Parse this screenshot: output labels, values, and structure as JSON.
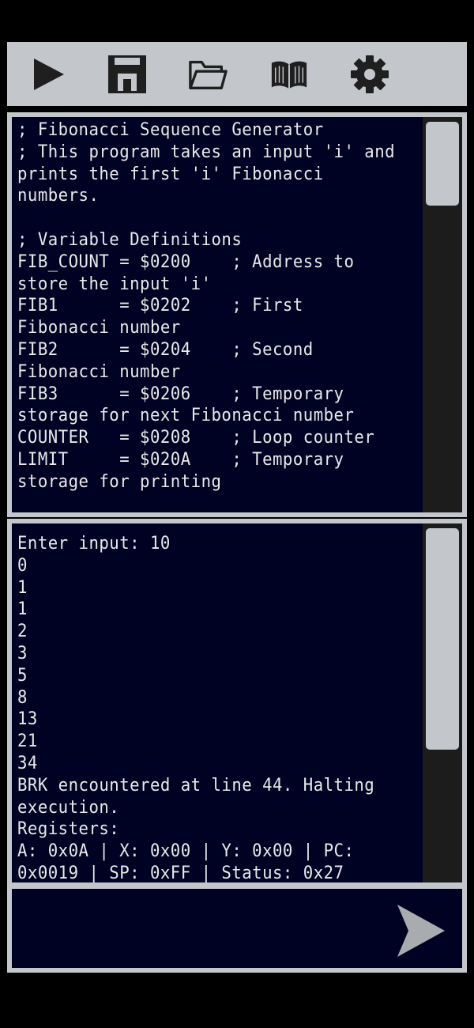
{
  "toolbar": {
    "buttons": [
      {
        "icon": "play-icon"
      },
      {
        "icon": "save-icon"
      },
      {
        "icon": "folder-open-icon"
      },
      {
        "icon": "book-icon"
      },
      {
        "icon": "gear-icon"
      }
    ]
  },
  "editor": {
    "code": "; Fibonacci Sequence Generator\n; This program takes an input 'i' and prints the first 'i' Fibonacci numbers.\n\n; Variable Definitions\nFIB_COUNT = $0200    ; Address to store the input 'i'\nFIB1      = $0202    ; First Fibonacci number\nFIB2      = $0204    ; Second Fibonacci number\nFIB3      = $0206    ; Temporary storage for next Fibonacci number\nCOUNTER   = $0208    ; Loop counter\nLIMIT     = $020A    ; Temporary storage for printing\n\n; Program Start"
  },
  "console": {
    "output": "Enter input: 10\n0\n1\n1\n2\n3\n5\n8\n13\n21\n34\nBRK encountered at line 44. Halting execution.\nRegisters:\nA: 0x0A | X: 0x00 | Y: 0x00 | PC: 0x0019 | SP: 0xFF | Status: 0x27"
  },
  "input": {
    "value": "",
    "placeholder": ""
  },
  "colors": {
    "panel_bg": "#000223",
    "frame": "#c3c7cb",
    "text": "#e9e9e9",
    "icon": "#1f1f1f",
    "send_icon": "#a9acaf"
  }
}
